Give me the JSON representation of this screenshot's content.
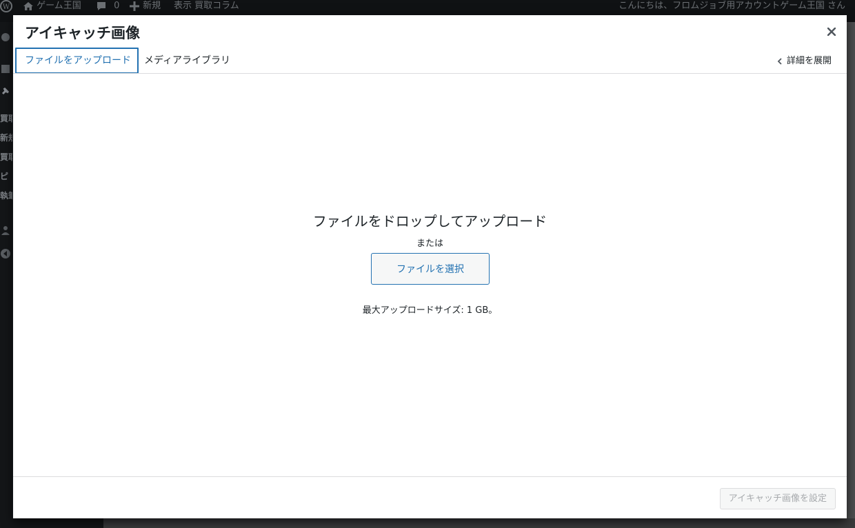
{
  "adminbar": {
    "site_name": "ゲーム王国",
    "comments_count": "0",
    "new_label": "新規",
    "view_label": "表示 買取コラム",
    "greeting": "こんにちは、フロムジョブ用アカウントゲーム王国 さん"
  },
  "sidebar": {
    "items": [
      "買取",
      "新規",
      "買取",
      "ピ",
      "執筆"
    ]
  },
  "modal": {
    "title": "アイキャッチ画像",
    "tabs": [
      {
        "label": "ファイルをアップロード",
        "active": true
      },
      {
        "label": "メディアライブラリ",
        "active": false
      }
    ],
    "expand_label": "詳細を展開",
    "drop_title": "ファイルをドロップしてアップロード",
    "or_text": "または",
    "select_button": "ファイルを選択",
    "max_size": "最大アップロードサイズ: 1 GB。",
    "set_button": "アイキャッチ画像を設定"
  },
  "colors": {
    "accent": "#2271b1",
    "adminbar_bg": "#101214",
    "disabled_text": "#a7aaad"
  },
  "icons": {
    "close": "close-icon",
    "chevron": "chevron-left-icon",
    "wordpress": "wordpress-logo-icon",
    "home": "home-icon",
    "comment": "comment-icon",
    "plus": "plus-icon"
  }
}
